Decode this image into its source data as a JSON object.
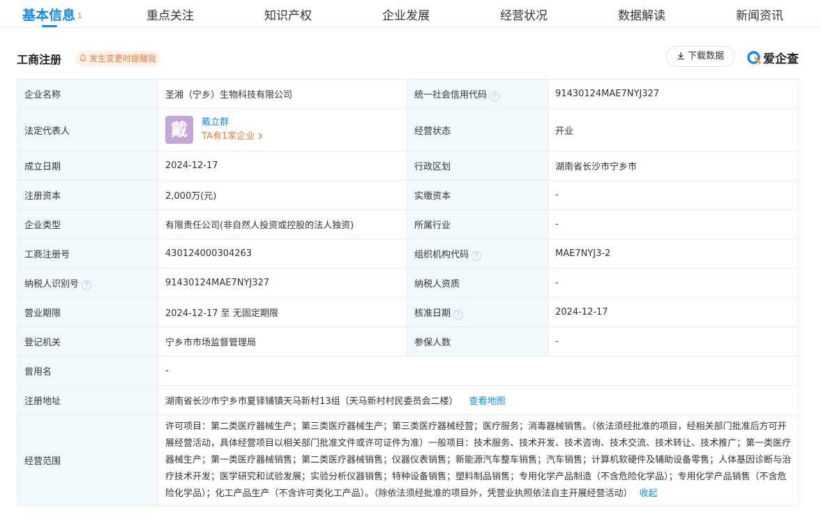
{
  "tabs": [
    {
      "label": "基本信息",
      "count": "1",
      "active": true
    },
    {
      "label": "重点关注"
    },
    {
      "label": "知识产权"
    },
    {
      "label": "企业发展"
    },
    {
      "label": "经营状况"
    },
    {
      "label": "数据解读"
    },
    {
      "label": "新闻资讯"
    }
  ],
  "section": {
    "title": "工商注册",
    "remind_label": "发生变更时提醒我",
    "download_label": "下载数据",
    "brand": "爱企查"
  },
  "info": {
    "company_name_label": "企业名称",
    "company_name": "圣湘（宁乡）生物科技有限公司",
    "credit_code_label": "统一社会信用代码",
    "credit_code": "91430124MAE7NYJ327",
    "legal_rep_label": "法定代表人",
    "legal_rep_avatar": "戴",
    "legal_rep_name": "戴立群",
    "legal_rep_link": "TA有1家企业",
    "status_label": "经营状态",
    "status": "开业",
    "founded_label": "成立日期",
    "founded": "2024-12-17",
    "region_label": "行政区划",
    "region": "湖南省长沙市宁乡市",
    "reg_capital_label": "注册资本",
    "reg_capital": "2,000万(元)",
    "paid_capital_label": "实缴资本",
    "paid_capital": "-",
    "type_label": "企业类型",
    "type": "有限责任公司(非自然人投资或控股的法人独资)",
    "industry_label": "所属行业",
    "industry": "-",
    "reg_no_label": "工商注册号",
    "reg_no": "430124000304263",
    "org_code_label": "组织机构代码",
    "org_code": "MAE7NYJ3-2",
    "taxpayer_id_label": "纳税人识别号",
    "taxpayer_id": "91430124MAE7NYJ327",
    "taxpayer_qual_label": "纳税人资质",
    "taxpayer_qual": "-",
    "term_label": "营业期限",
    "term": "2024-12-17 至 无固定期限",
    "approval_label": "核准日期",
    "approval": "2024-12-17",
    "authority_label": "登记机关",
    "authority": "宁乡市市场监督管理局",
    "insured_label": "参保人数",
    "insured": "-",
    "former_name_label": "曾用名",
    "former_name": "-",
    "address_label": "注册地址",
    "address": "湖南省长沙市宁乡市夏铎铺镇天马新村13组（天马新村村民委员会二楼）",
    "address_link": "查看地图",
    "scope_label": "经营范围",
    "scope": "许可项目：第二类医疗器械生产；第三类医疗器械生产；第三类医疗器械经营；医疗服务；消毒器械销售。（依法须经批准的项目，经相关部门批准后方可开展经营活动，具体经营项目以相关部门批准文件或许可证件为准）一般项目：技术服务、技术开发、技术咨询、技术交流、技术转让、技术推广；第一类医疗器械生产；第一类医疗器械销售；第二类医疗器械销售；仪器仪表销售；新能源汽车整车销售；汽车销售；计算机软硬件及辅助设备零售；人体基因诊断与治疗技术开发；医学研究和试验发展；实验分析仪器销售；特种设备销售；塑料制品销售；专用化学产品制造（不含危险化学品）；专用化学产品销售（不含危险化学品）；化工产品生产（不含许可类化工产品）。（除依法须经批准的项目外，凭营业执照依法自主开展经营活动）",
    "scope_collapse": "收起"
  },
  "colors": {
    "accent": "#128bed",
    "warn": "#f07a3a",
    "label_bg": "#f2f9fc"
  },
  "icons": [
    "bell-icon",
    "download-icon",
    "help-icon",
    "chevron-right-icon",
    "aiqicha-logo-icon"
  ]
}
